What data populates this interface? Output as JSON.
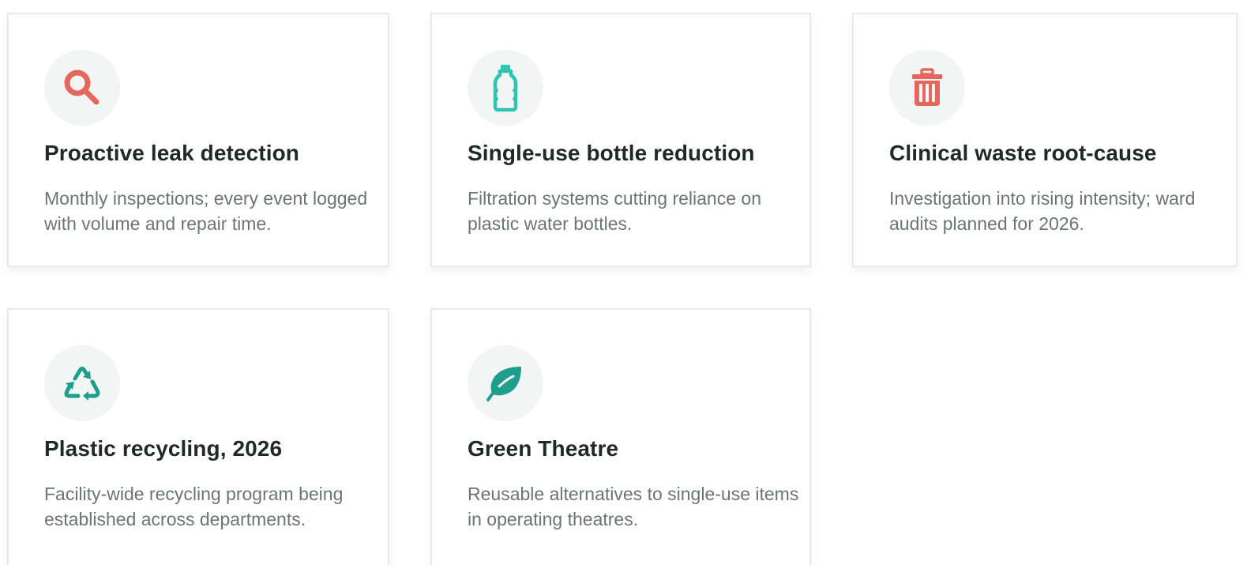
{
  "colors": {
    "coral": "#e4675d",
    "teal": "#1e9e8c",
    "turquoise": "#2ec4b0",
    "title": "#1f2a28",
    "body": "#6b7573",
    "icon_bg": "#f3f5f4"
  },
  "cards": [
    {
      "icon": "magnifier-icon",
      "title": "Proactive leak detection",
      "description": "Monthly inspections; every event logged with volume and repair time."
    },
    {
      "icon": "bottle-icon",
      "title": "Single-use bottle reduction",
      "description": "Filtration systems cutting reliance on plastic water bottles."
    },
    {
      "icon": "trash-icon",
      "title": "Clinical waste root-cause",
      "description": "Investigation into rising intensity; ward audits planned for 2026."
    },
    {
      "icon": "recycle-icon",
      "title": "Plastic recycling, 2026",
      "description": "Facility-wide recycling program being established across departments."
    },
    {
      "icon": "leaf-icon",
      "title": "Green Theatre",
      "description": "Reusable alternatives to single-use items in operating theatres."
    }
  ]
}
